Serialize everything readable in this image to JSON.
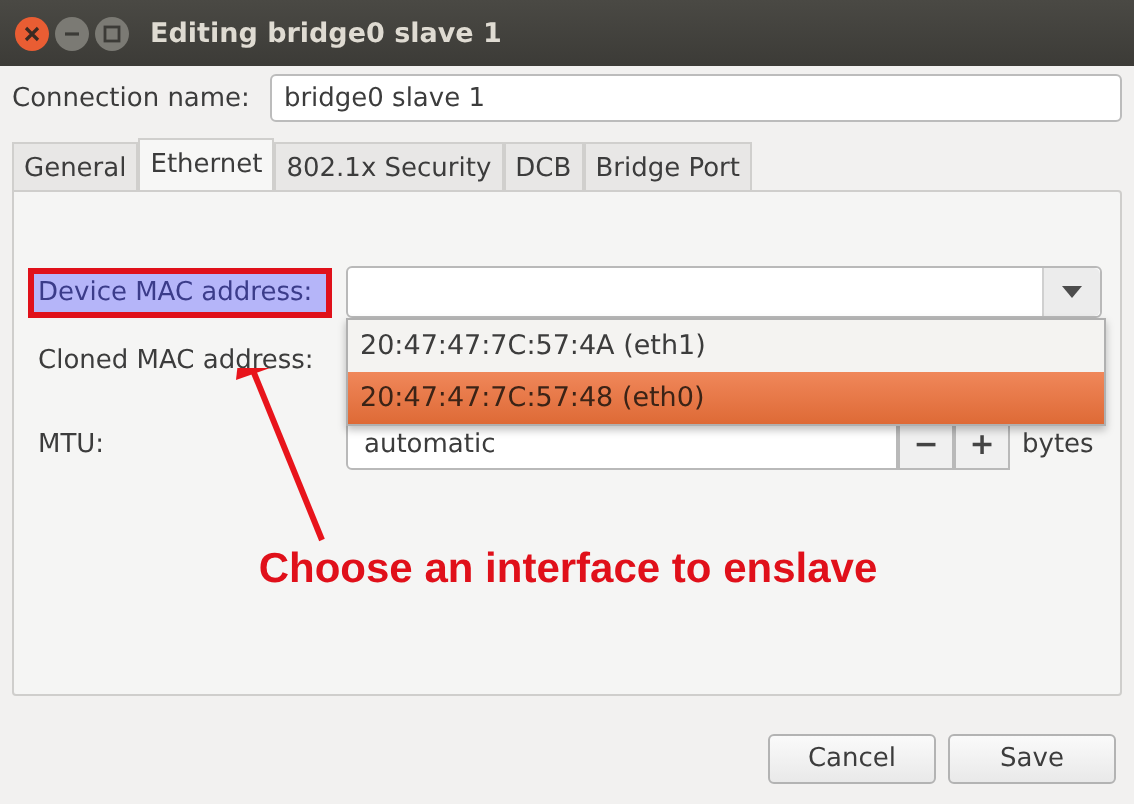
{
  "window": {
    "title": "Editing bridge0 slave 1"
  },
  "connection_name": {
    "label": "Connection name:",
    "value": "bridge0 slave 1"
  },
  "tabs": [
    {
      "label": "General",
      "selected": false
    },
    {
      "label": "Ethernet",
      "selected": true
    },
    {
      "label": "802.1x Security",
      "selected": false
    },
    {
      "label": "DCB",
      "selected": false
    },
    {
      "label": "Bridge Port",
      "selected": false
    }
  ],
  "device_mac": {
    "label": "Device MAC address:",
    "highlighted": true
  },
  "dropdown_options": [
    {
      "label": "20:47:47:7C:57:4A (eth1)",
      "selected": false
    },
    {
      "label": "20:47:47:7C:57:48 (eth0)",
      "selected": true
    }
  ],
  "cloned_mac": {
    "label": "Cloned MAC address:"
  },
  "mtu": {
    "label": "MTU:",
    "value": "automatic",
    "minus": "−",
    "plus": "+",
    "unit": "bytes"
  },
  "annotation": "Choose an interface to enslave",
  "buttons": [
    "Cancel",
    "Save"
  ]
}
